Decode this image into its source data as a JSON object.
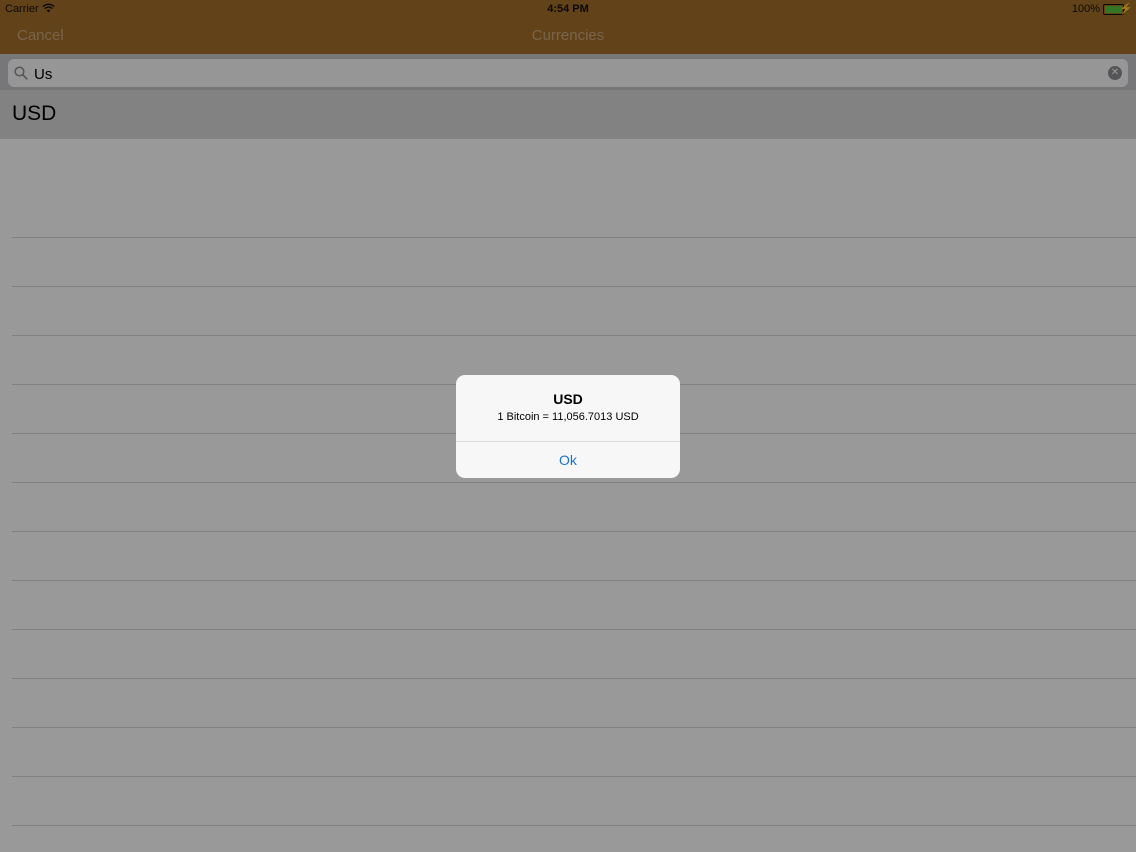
{
  "status_bar": {
    "carrier": "Carrier",
    "time": "4:54 PM",
    "battery_percent": "100%",
    "wifi_icon": "wifi-icon",
    "battery_icon": "battery-icon",
    "charging_icon": "bolt-icon"
  },
  "nav": {
    "cancel_label": "Cancel",
    "title": "Currencies"
  },
  "search": {
    "value": "Us",
    "search_icon": "search-icon",
    "clear_icon": "clear-icon"
  },
  "list": {
    "items": [
      {
        "label": "USD",
        "selected": true
      }
    ]
  },
  "alert": {
    "title": "USD",
    "message": "1 Bitcoin = 11,056.7013 USD",
    "ok_label": "Ok"
  },
  "colors": {
    "nav_background": "#a46f28",
    "alert_button": "#1a73c9",
    "battery_fill": "#58c43b"
  }
}
